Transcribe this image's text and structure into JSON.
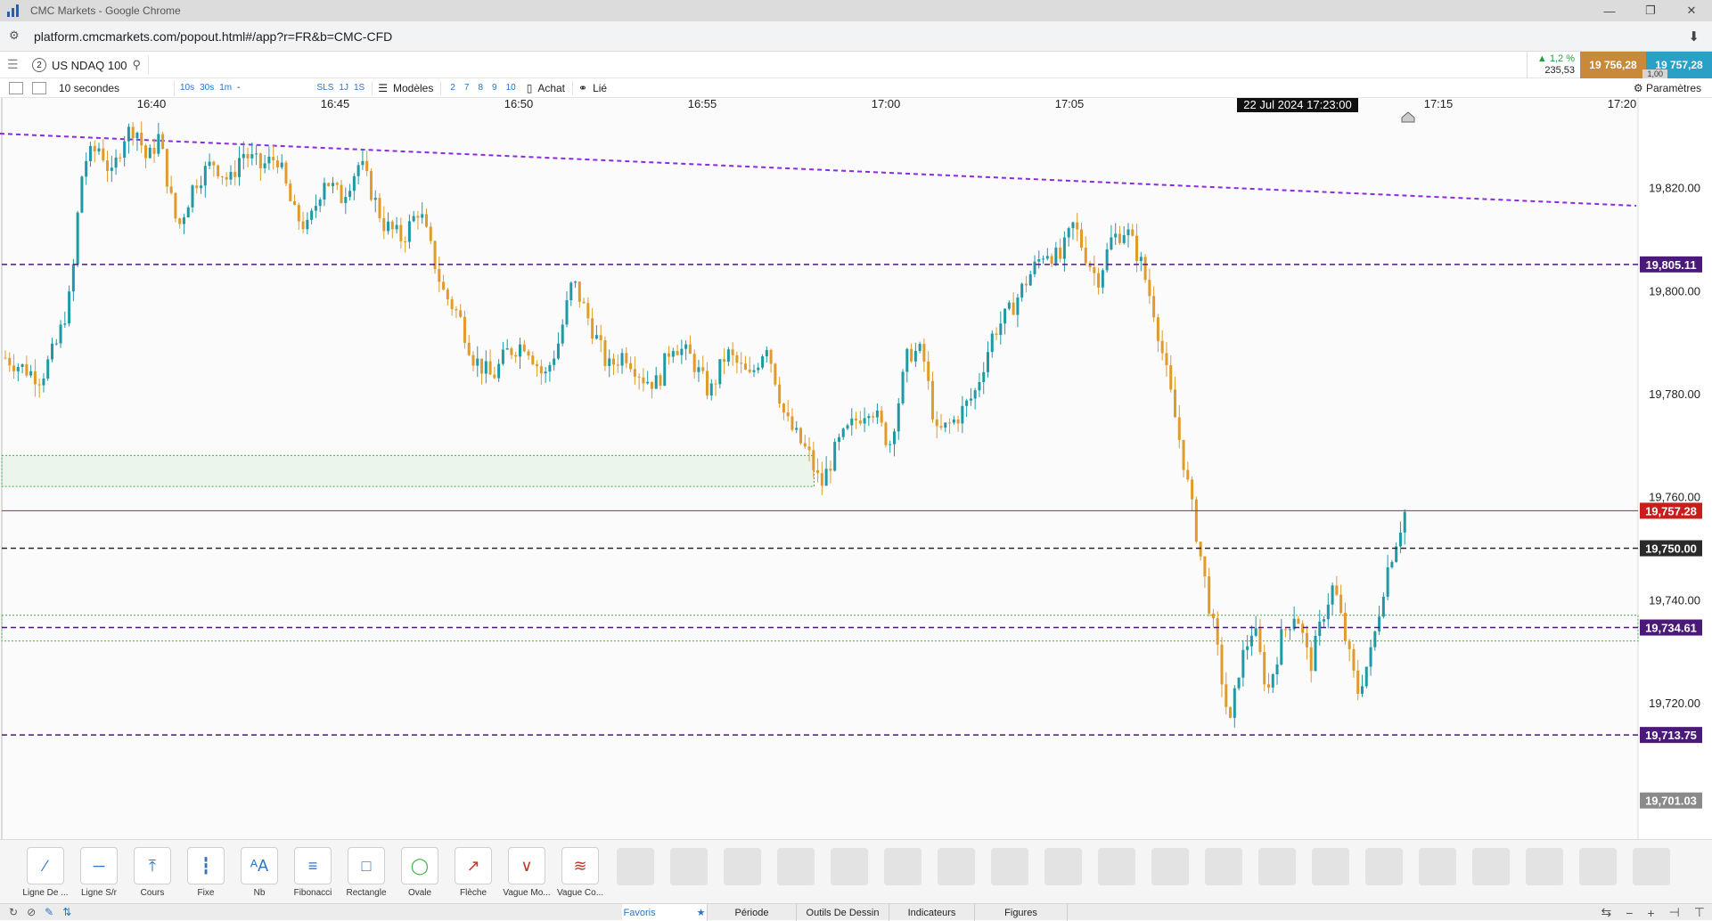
{
  "window": {
    "title": "CMC Markets - Google Chrome"
  },
  "browser": {
    "url": "platform.cmcmarkets.com/popout.html#/app?r=FR&b=CMC-CFD"
  },
  "instrument": {
    "slot": "2",
    "name": "US NDAQ 100"
  },
  "prices": {
    "change_pct": "▲ 1,2 %",
    "change_pts": "235,53",
    "sell": "19 756,28",
    "buy": "19 757,28",
    "spread": "1,00"
  },
  "toolbar": {
    "interval": "10 secondes",
    "tf_10s": "10s",
    "tf_30s": "30s",
    "tf_1m": "1m",
    "tf_dash": "-",
    "sls": "SLS",
    "j1": "1J",
    "s1": "1S",
    "models": "Modèles",
    "n2": "2",
    "n7": "7",
    "n8": "8",
    "n9": "9",
    "n10": "10",
    "achat": "Achat",
    "lie": "Lié",
    "params": "Paramètres"
  },
  "chart_data": {
    "type": "candlestick",
    "x_ticks": [
      "16:40",
      "16:45",
      "16:50",
      "16:55",
      "17:00",
      "17:05",
      "17:15",
      "17:20"
    ],
    "crosshair_time": "22 Jul 2024 17:23:00",
    "y_ticks": [
      "19,820.00",
      "19,800.00",
      "19,780.00",
      "19,760.00",
      "19,740.00",
      "19,720.00"
    ],
    "ylim": [
      19697,
      19835
    ],
    "levels": [
      {
        "label": "19,805.11",
        "value": 19805.11,
        "color": "#4b1a78",
        "style": "dashed"
      },
      {
        "label": "19,757.28",
        "value": 19757.28,
        "color": "#c81e1e",
        "style": "solid"
      },
      {
        "label": "19,750.00",
        "value": 19750.0,
        "color": "#2a2a2a",
        "style": "dashed"
      },
      {
        "label": "19,734.61",
        "value": 19734.61,
        "color": "#4b1a78",
        "style": "dashed"
      },
      {
        "label": "19,713.75",
        "value": 19713.75,
        "color": "#4b1a78",
        "style": "dashed"
      },
      {
        "label": "19,701.03",
        "value": 19701.03,
        "color": "#8a8a8a",
        "style": "none"
      }
    ],
    "trendline": {
      "color": "#8a2be2",
      "start": 19830.5,
      "end": 19816.5
    },
    "zone_upper": {
      "color": "#3cb043",
      "top": 19768,
      "bottom": 19762,
      "x_end_fraction": 0.497
    },
    "zone_lower": {
      "color": "#3cb043",
      "top": 19737,
      "bottom": 19732,
      "x_end_fraction": 1.0
    },
    "colors": {
      "up": "#1f9aa5",
      "down": "#e09b2a"
    },
    "close_path": [
      [
        0,
        19787
      ],
      [
        15,
        19783
      ],
      [
        22,
        19790
      ],
      [
        28,
        19800
      ],
      [
        30,
        19812
      ],
      [
        33,
        19825
      ],
      [
        40,
        19828
      ],
      [
        45,
        19822
      ],
      [
        50,
        19830
      ],
      [
        55,
        19832
      ],
      [
        60,
        19825
      ],
      [
        65,
        19830
      ],
      [
        70,
        19818
      ],
      [
        73,
        19812
      ],
      [
        80,
        19821
      ],
      [
        88,
        19825
      ],
      [
        95,
        19821
      ],
      [
        100,
        19827
      ],
      [
        108,
        19824
      ],
      [
        115,
        19826
      ],
      [
        122,
        19815
      ],
      [
        128,
        19812
      ],
      [
        135,
        19822
      ],
      [
        142,
        19818
      ],
      [
        150,
        19825
      ],
      [
        160,
        19813
      ],
      [
        168,
        19810
      ],
      [
        175,
        19816
      ],
      [
        185,
        19800
      ],
      [
        192,
        19795
      ],
      [
        198,
        19787
      ],
      [
        206,
        19783
      ],
      [
        212,
        19788
      ],
      [
        220,
        19790
      ],
      [
        228,
        19783
      ],
      [
        234,
        19790
      ],
      [
        240,
        19802
      ],
      [
        248,
        19793
      ],
      [
        255,
        19785
      ],
      [
        262,
        19788
      ],
      [
        270,
        19783
      ],
      [
        276,
        19782
      ],
      [
        282,
        19790
      ],
      [
        290,
        19787
      ],
      [
        298,
        19780
      ],
      [
        305,
        19788
      ],
      [
        315,
        19783
      ],
      [
        322,
        19790
      ],
      [
        330,
        19775
      ],
      [
        340,
        19768
      ],
      [
        345,
        19762
      ],
      [
        352,
        19770
      ],
      [
        360,
        19775
      ],
      [
        366,
        19778
      ],
      [
        374,
        19770
      ],
      [
        382,
        19788
      ],
      [
        388,
        19788
      ],
      [
        394,
        19772
      ],
      [
        402,
        19775
      ],
      [
        410,
        19780
      ],
      [
        418,
        19792
      ],
      [
        425,
        19796
      ],
      [
        432,
        19802
      ],
      [
        440,
        19808
      ],
      [
        446,
        19806
      ],
      [
        452,
        19813
      ],
      [
        456,
        19808
      ],
      [
        462,
        19802
      ],
      [
        468,
        19810
      ],
      [
        474,
        19812
      ],
      [
        480,
        19806
      ],
      [
        486,
        19796
      ],
      [
        492,
        19782
      ],
      [
        498,
        19768
      ],
      [
        505,
        19750
      ],
      [
        512,
        19732
      ],
      [
        518,
        19715
      ],
      [
        522,
        19727
      ],
      [
        528,
        19735
      ],
      [
        534,
        19722
      ],
      [
        540,
        19733
      ],
      [
        546,
        19738
      ],
      [
        552,
        19727
      ],
      [
        558,
        19738
      ],
      [
        562,
        19743
      ],
      [
        567,
        19732
      ],
      [
        572,
        19722
      ],
      [
        578,
        19730
      ],
      [
        584,
        19745
      ],
      [
        592,
        19757
      ]
    ]
  },
  "drawing_tools": [
    {
      "icon": "trendline-icon",
      "label": "Ligne De ..."
    },
    {
      "icon": "horizontal-line-icon",
      "label": "Ligne S/r"
    },
    {
      "icon": "price-line-icon",
      "label": "Cours"
    },
    {
      "icon": "fixed-line-icon",
      "label": "Fixe"
    },
    {
      "icon": "text-icon",
      "label": "Nb"
    },
    {
      "icon": "fibonacci-icon",
      "label": "Fibonacci"
    },
    {
      "icon": "rectangle-icon",
      "label": "Rectangle"
    },
    {
      "icon": "ellipse-icon",
      "label": "Ovale"
    },
    {
      "icon": "arrow-icon",
      "label": "Flèche"
    },
    {
      "icon": "wave-icon",
      "label": "Vague Mo..."
    },
    {
      "icon": "wave2-icon",
      "label": "Vague Co..."
    }
  ],
  "tabs": {
    "favoris": "Favoris",
    "periode": "Période",
    "outils": "Outils De Dessin",
    "indicateurs": "Indicateurs",
    "figures": "Figures"
  },
  "icons": {
    "text_icon_glyph": "ᴬA"
  }
}
